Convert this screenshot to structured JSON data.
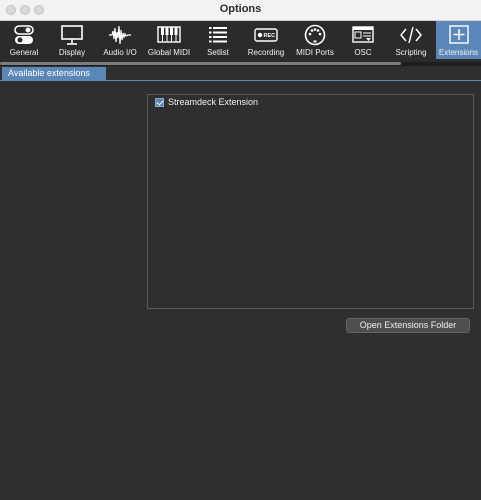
{
  "window": {
    "title": "Options"
  },
  "toolbar": {
    "items": [
      {
        "label": "General",
        "icon": "toggle-icon"
      },
      {
        "label": "Display",
        "icon": "monitor-icon"
      },
      {
        "label": "Audio I/O",
        "icon": "waveform-icon"
      },
      {
        "label": "Global MIDI",
        "icon": "piano-keys-icon"
      },
      {
        "label": "Setlist",
        "icon": "list-icon"
      },
      {
        "label": "Recording",
        "icon": "rec-icon"
      },
      {
        "label": "MIDI Ports",
        "icon": "midi-port-icon"
      },
      {
        "label": "OSC",
        "icon": "osc-icon"
      },
      {
        "label": "Scripting",
        "icon": "code-icon"
      },
      {
        "label": "Extensions",
        "icon": "plus-square-icon",
        "active": true
      }
    ],
    "rec_badge": "REC"
  },
  "tabs": {
    "available_extensions": "Available extensions"
  },
  "extensions": [
    {
      "label": "Streamdeck Extension",
      "checked": true
    }
  ],
  "buttons": {
    "open_folder": "Open Extensions Folder"
  },
  "colors": {
    "accent": "#5b87b8",
    "background": "#2f2f2f"
  }
}
